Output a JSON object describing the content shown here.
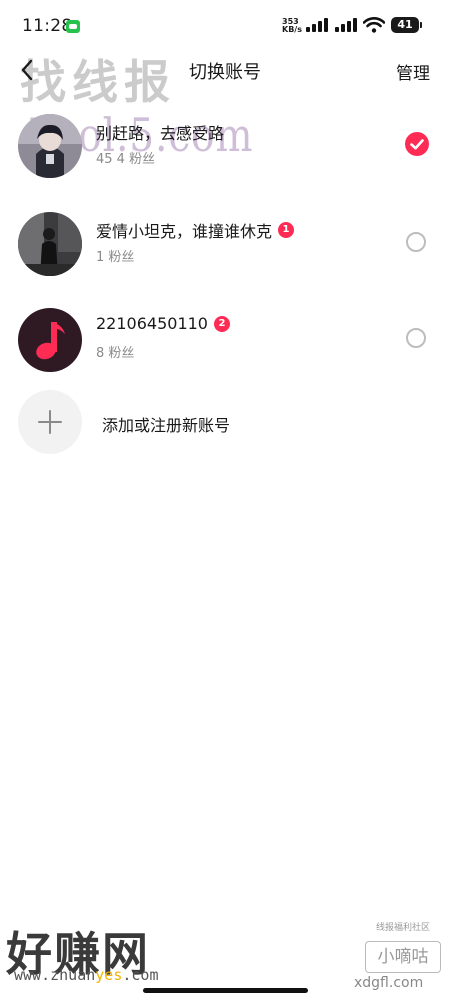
{
  "status_bar": {
    "time": "11:28",
    "net_speed_value": "353",
    "net_speed_unit": "KB/s",
    "battery": "41"
  },
  "watermarks": {
    "top": "找线报",
    "mid": "Tool.5.com",
    "bottom_left": "好赚网",
    "url_prefix": "www.zhuan",
    "url_highlight": "yes",
    "url_suffix": ".com",
    "right_small": "线报福利社区",
    "right_main": "小嘀咕",
    "right_url": "xdgfl.com"
  },
  "nav": {
    "title": "切换账号",
    "manage_label": "管理"
  },
  "accounts": [
    {
      "name": "别赶路，去感受路",
      "fans": "45 4 粉丝",
      "badge": "",
      "selected": true
    },
    {
      "name": "爱情小坦克，谁撞谁休克",
      "fans": "1 粉丝",
      "badge": "1",
      "selected": false
    },
    {
      "name": "22106450110",
      "fans": "8 粉丝",
      "badge": "2",
      "selected": false
    }
  ],
  "add_account": {
    "label": "添加或注册新账号"
  },
  "colors": {
    "accent": "#fe2c55",
    "secondary_text": "#8a8a8a",
    "radio_border": "#bdbdbd",
    "add_bg": "#f2f2f2"
  },
  "icons": {
    "back": "chevron-left-icon",
    "check": "check-icon",
    "add": "plus-icon",
    "music": "music-note-icon"
  }
}
